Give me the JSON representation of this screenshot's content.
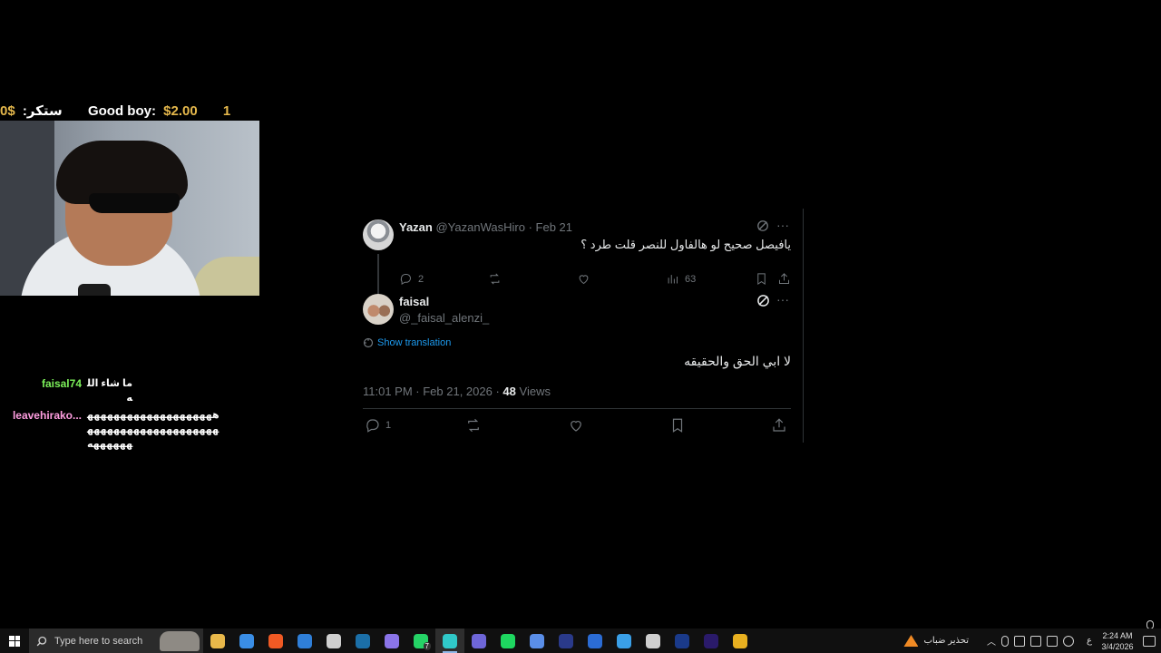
{
  "overlay": {
    "ticker": {
      "item1_amount": "0$",
      "item1_label": "ستكر:",
      "item2_label": "Good boy:",
      "item2_amount": "$2.00",
      "item3_amount": "1"
    },
    "chat": [
      {
        "user": "faisal74",
        "user_color": "#7cf05a",
        "text": "ما شاء الله"
      },
      {
        "user": "leavehirako...",
        "user_color": "#ff9ee0",
        "text": "ههههههههههههههههههههههههههههههههههههههههههههههه"
      }
    ]
  },
  "thread": {
    "parent": {
      "name": "Yazan",
      "handle": "@YazanWasHiro",
      "separator": "·",
      "date": "Feb 21",
      "text": "يافيصل صحيح لو هالفاول للنصر قلت طرد ؟",
      "replies": "2",
      "views": "63"
    },
    "main": {
      "name": "faisal",
      "handle": "@_faisal_alenzi_",
      "translate_label": "Show translation",
      "text": "لا ابي الحق والحقيقه",
      "timestamp": "11:01 PM · Feb 21, 2026 ·",
      "views_count": "48",
      "views_label": "Views",
      "replies": "1"
    }
  },
  "taskbar": {
    "search_placeholder": "Type here to search",
    "weather_text": "تحذير ضباب",
    "lang": "ع",
    "time": "2:24 AM",
    "date": "3/4/2026",
    "whatsapp_badge": "7",
    "apps": [
      {
        "name": "file-explorer",
        "color": "#e8b84a"
      },
      {
        "name": "microsoft-store",
        "color": "#3a8ee6"
      },
      {
        "name": "brave-browser",
        "color": "#f05a24"
      },
      {
        "name": "mail",
        "color": "#2f7fd8"
      },
      {
        "name": "steam-alt",
        "color": "#cfcfcf"
      },
      {
        "name": "steam",
        "color": "#1b6fa8"
      },
      {
        "name": "discord",
        "color": "#8a74e8"
      },
      {
        "name": "whatsapp",
        "color": "#25d366"
      },
      {
        "name": "tiktok-studio",
        "color": "#30c9c9"
      },
      {
        "name": "game-app",
        "color": "#6e66d8"
      },
      {
        "name": "spotify",
        "color": "#1ed760"
      },
      {
        "name": "vpn",
        "color": "#5a8ee8"
      },
      {
        "name": "terminal",
        "color": "#2a3a8a"
      },
      {
        "name": "word",
        "color": "#2b6cd4"
      },
      {
        "name": "window-app",
        "color": "#3aa0e8"
      },
      {
        "name": "obs",
        "color": "#cfcfcf"
      },
      {
        "name": "fresco",
        "color": "#1a3a8a"
      },
      {
        "name": "premiere-pro",
        "color": "#2a1a6a"
      },
      {
        "name": "game-badge",
        "color": "#e8b020"
      }
    ]
  }
}
